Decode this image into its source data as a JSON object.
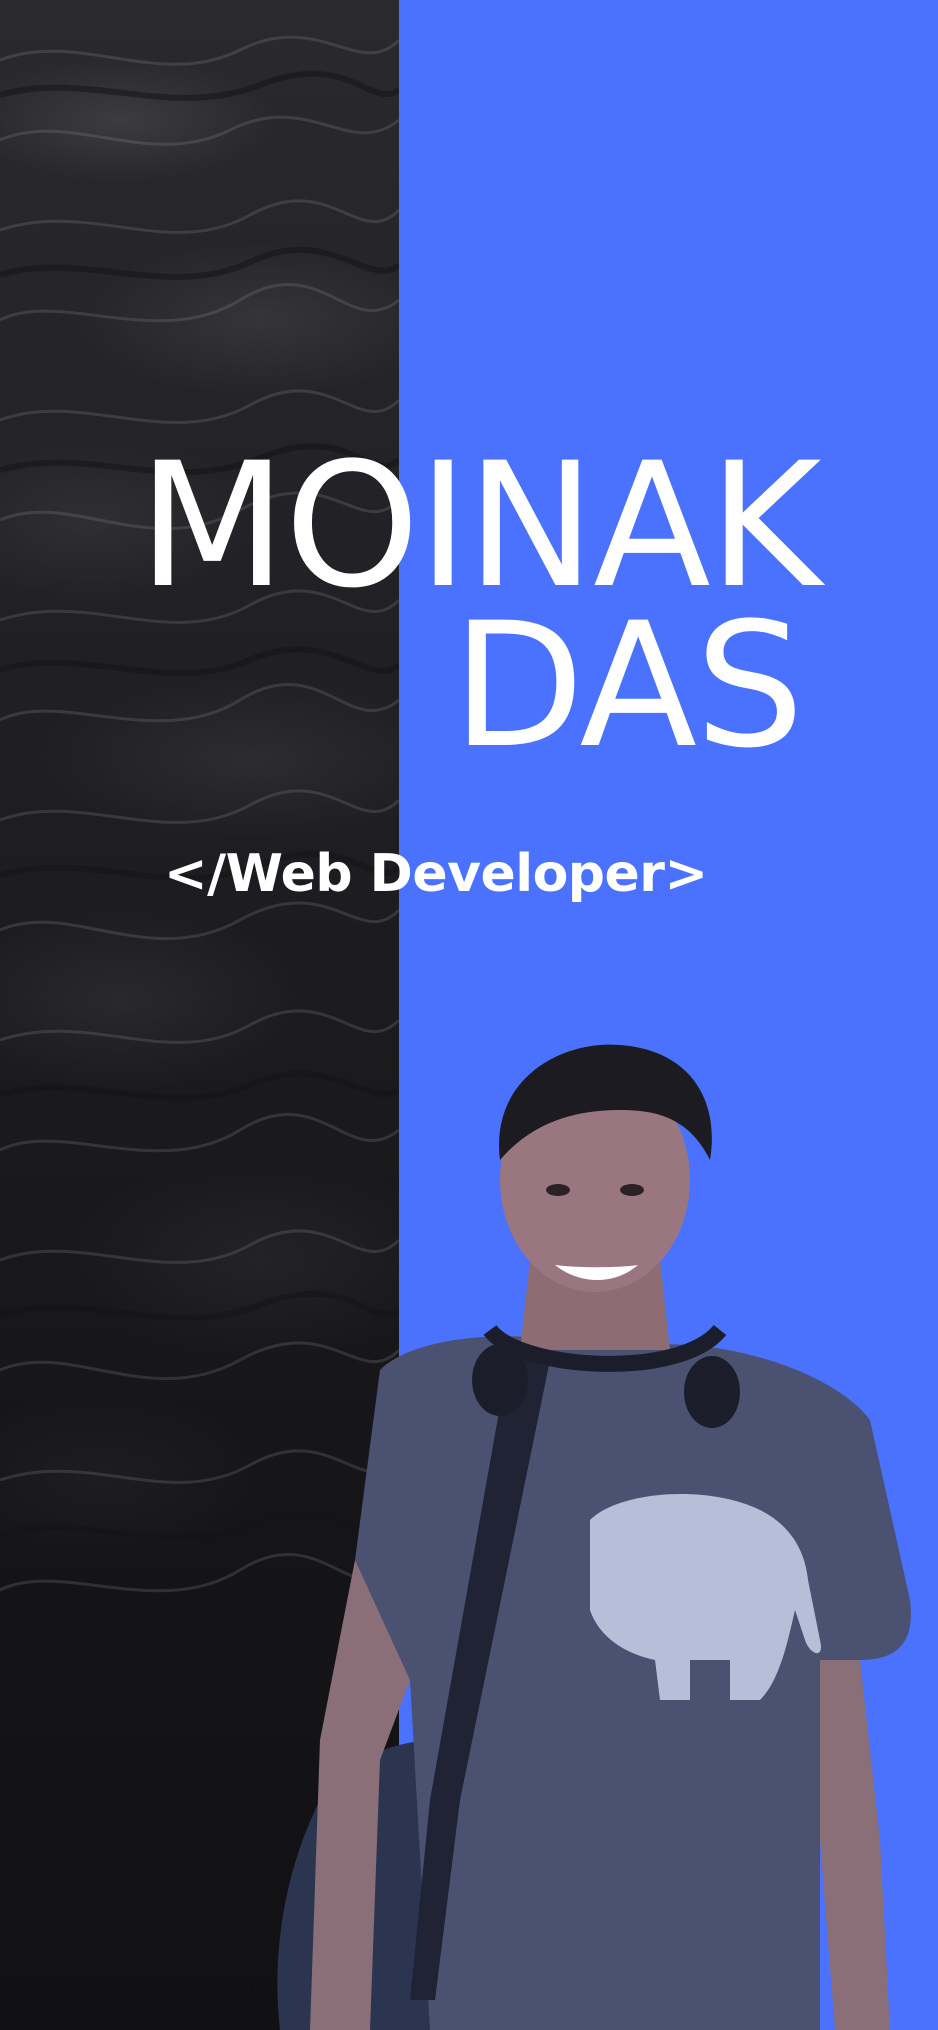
{
  "profile": {
    "first_name": "MOINAK",
    "last_name": "DAS",
    "role": "</Web Developer>"
  },
  "colors": {
    "accent_blue": "#4a72ff",
    "dark_panel": "#151518",
    "text": "#ffffff"
  }
}
